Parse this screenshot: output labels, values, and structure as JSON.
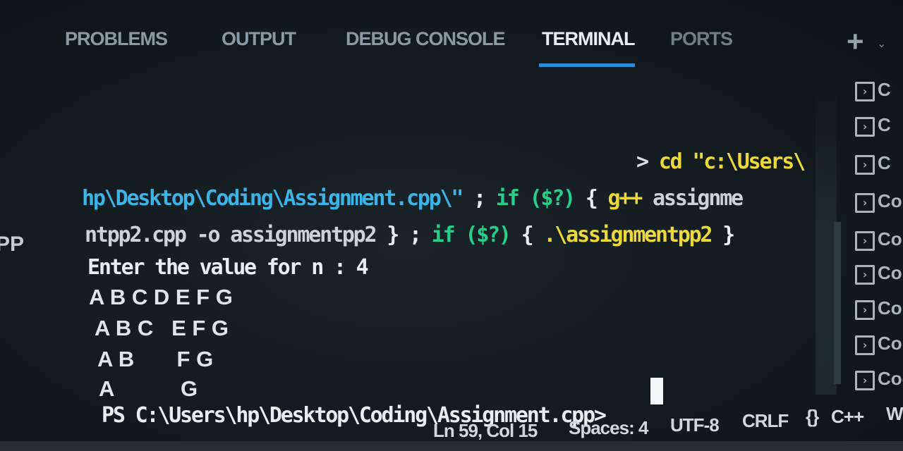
{
  "panel_tabs": [
    {
      "label": "PROBLEMS"
    },
    {
      "label": "OUTPUT"
    },
    {
      "label": "DEBUG CONSOLE"
    },
    {
      "label": "TERMINAL",
      "active": true
    },
    {
      "label": "PORTS"
    }
  ],
  "toolbar": {
    "add_icon": "+",
    "dropdown_icon": "⌄"
  },
  "terminal": {
    "left_fragment": "PP",
    "cmd_line1": {
      "arrow": ">",
      "text": "cd \"c:\\Users\\"
    },
    "cmd_line2": {
      "path": "hp\\Desktop\\Coding\\Assignment.cpp\\\"",
      "sep1": " ; ",
      "if1": "if",
      "cond1": " ($?) ",
      "brace1": "{ ",
      "compiler": "g++",
      "arg": " assignme"
    },
    "cmd_line3": {
      "arg": "ntpp2.cpp -o assignmentpp2",
      "close1": " } ",
      "sep2": "; ",
      "if2": "if",
      "cond2": " ($?) ",
      "brace2": "{ ",
      "exe": ".\\assignmentpp2",
      "close2": " }"
    },
    "output_prompt": "Enter the value for n : 4",
    "pattern_rows": [
      "A B C D E F G",
      "A B C   E F G",
      "A B       F G",
      "A           G"
    ],
    "ps_prompt": "PS C:\\Users\\hp\\Desktop\\Coding\\Assignment.cpp>"
  },
  "terminal_list": {
    "items": [
      {
        "icon": "terminal-icon",
        "label": "C"
      },
      {
        "icon": "terminal-icon",
        "label": "C"
      },
      {
        "icon": "terminal-icon",
        "label": "C"
      },
      {
        "icon": "terminal-icon",
        "label": "Co"
      },
      {
        "icon": "terminal-icon",
        "label": "Co"
      },
      {
        "icon": "terminal-icon",
        "label": "Co"
      },
      {
        "icon": "terminal-icon",
        "label": "Co"
      },
      {
        "icon": "terminal-icon",
        "label": "Co"
      },
      {
        "icon": "terminal-icon",
        "label": "Coc"
      }
    ]
  },
  "statusbar": {
    "position": "Ln 59, Col 15",
    "spaces": "Spaces: 4",
    "encoding": "UTF-8",
    "eol": "CRLF",
    "braces": "{}",
    "language": "C++",
    "overflow": "W"
  },
  "colors": {
    "background": "#121b1f",
    "tab_active_underline": "#2a8ed8",
    "cyan": "#3cb4e8",
    "yellow": "#ecd83a",
    "green": "#28cf8a"
  }
}
